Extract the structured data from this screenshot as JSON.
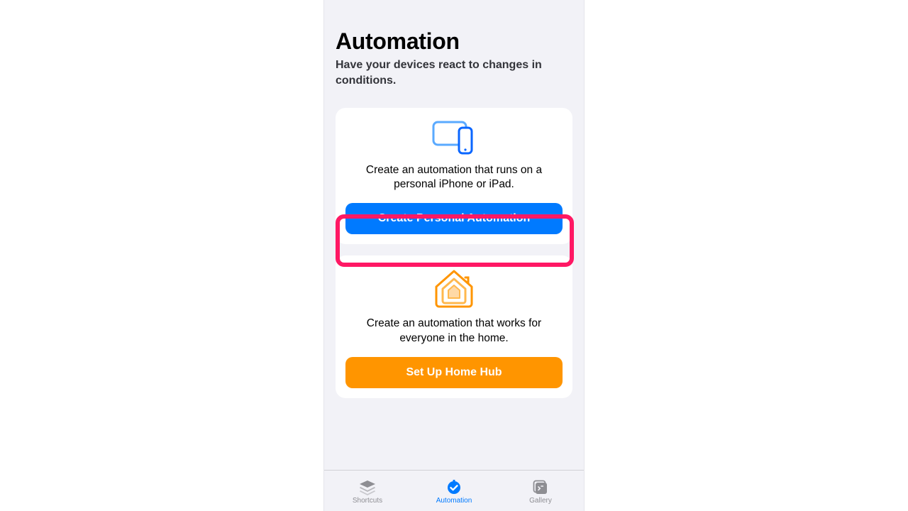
{
  "header": {
    "title": "Automation",
    "subtitle": "Have your devices react to changes in conditions."
  },
  "personal": {
    "description": "Create an automation that runs on a personal iPhone or iPad.",
    "button_label": "Create Personal Automation",
    "highlighted": true
  },
  "home": {
    "description": "Create an automation that works for everyone in the home.",
    "button_label": "Set Up Home Hub"
  },
  "tabs": {
    "shortcuts": "Shortcuts",
    "automation": "Automation",
    "gallery": "Gallery"
  },
  "colors": {
    "accent_blue": "#007aff",
    "accent_orange": "#ff9500",
    "highlight_pink": "#ff1864",
    "bg": "#f2f2f7"
  }
}
